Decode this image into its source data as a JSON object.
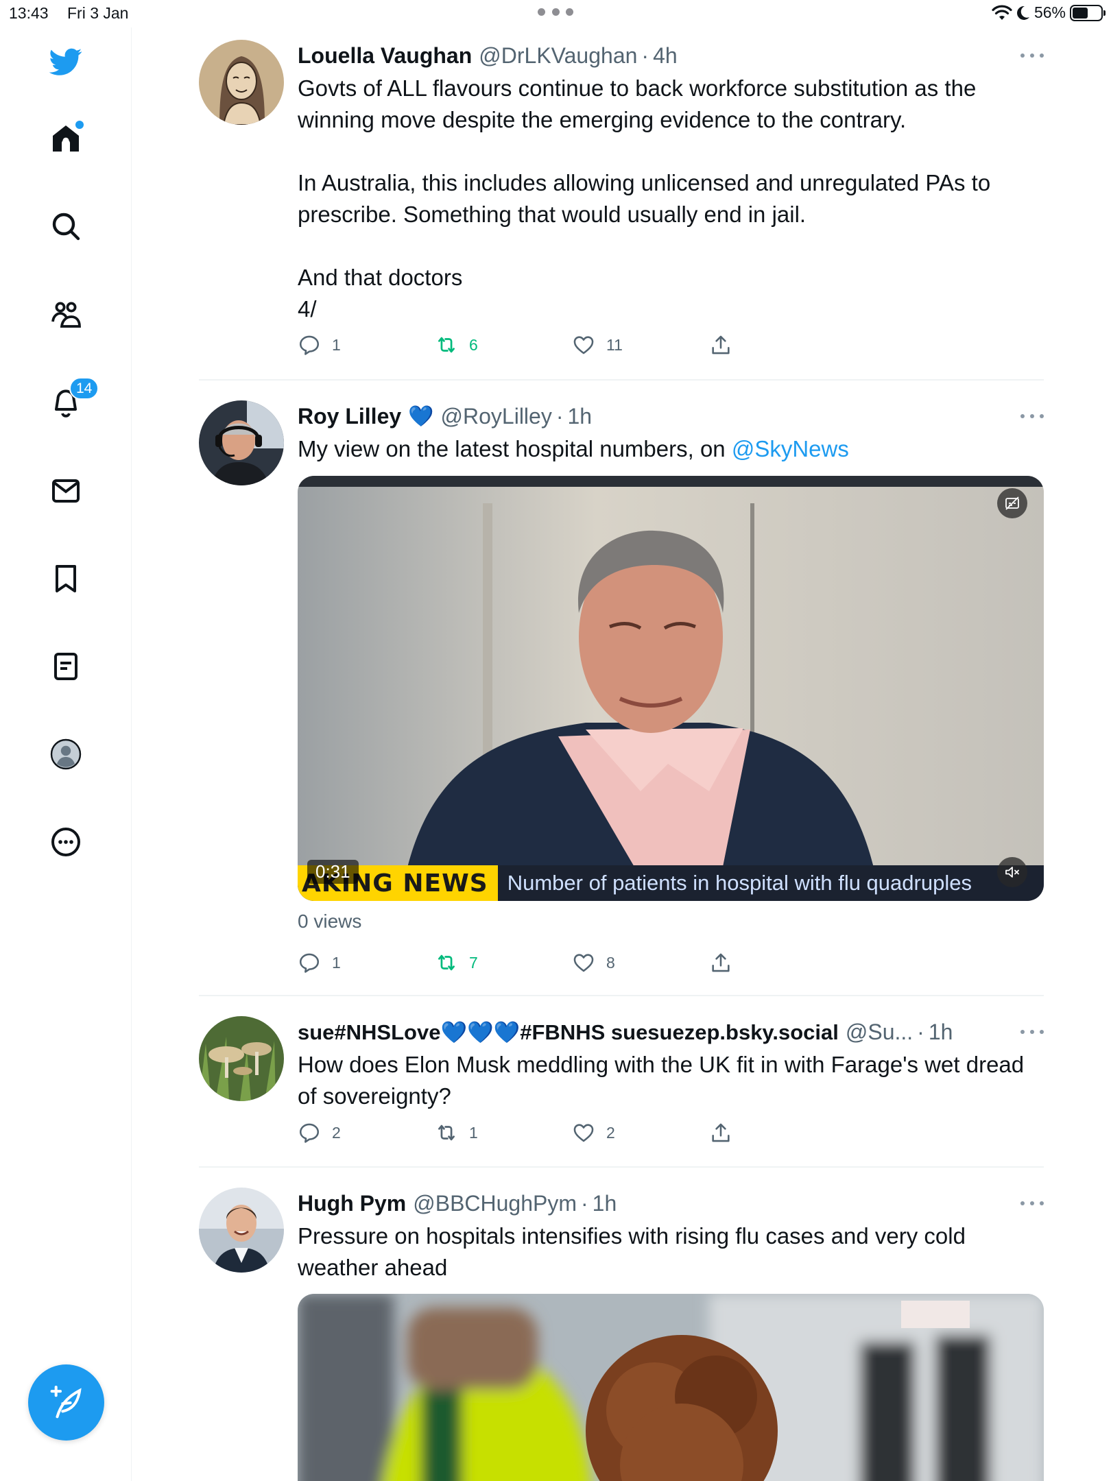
{
  "status_bar": {
    "time": "13:43",
    "date": "Fri 3 Jan",
    "battery": "56%",
    "battery_level": 0.56
  },
  "sidebar": {
    "items": [
      {
        "icon": "home-icon",
        "label": "Home"
      },
      {
        "icon": "search-icon",
        "label": "Explore"
      },
      {
        "icon": "communities-icon",
        "label": "Communities"
      },
      {
        "icon": "bell-icon",
        "label": "Notifications"
      },
      {
        "icon": "mail-icon",
        "label": "Messages"
      },
      {
        "icon": "bookmark-icon",
        "label": "Bookmarks"
      },
      {
        "icon": "lists-icon",
        "label": "Lists"
      },
      {
        "icon": "profile-icon",
        "label": "Profile"
      },
      {
        "icon": "more-circle-icon",
        "label": "More"
      }
    ],
    "notifications_badge": "14",
    "compose_icon": "compose-feather-icon"
  },
  "colors": {
    "accent": "#1d9bf0",
    "retweet": "#00ba7c",
    "text_primary": "#0f1419",
    "text_secondary": "#536471",
    "divider": "#eff3f4"
  },
  "tweets": [
    {
      "name": "Louella Vaughan",
      "handle": "@DrLKVaughan",
      "sep": "·",
      "time": "4h",
      "text": "Govts of ALL flavours continue to back workforce substitution as the winning move despite the emerging evidence to the contrary.\n\nIn Australia, this includes allowing unlicensed and unregulated PAs to prescribe. Something that would usually end in jail.\n\nAnd that doctors\n4/",
      "replies": "1",
      "retweets": "6",
      "likes": "11"
    },
    {
      "name": "Roy Lilley",
      "name_emoji": "💙",
      "handle": "@RoyLilley",
      "sep": "·",
      "time": "1h",
      "text_prefix": "My view on the latest hospital numbers, on ",
      "mention": "@SkyNews",
      "video": {
        "duration": "0:31",
        "ticker_tag": "AKING NEWS",
        "ticker_text": "Number of patients in hospital with flu quadruples"
      },
      "views": "0 views",
      "replies": "1",
      "retweets": "7",
      "likes": "8"
    },
    {
      "name": "sue#NHSLove💙💙💙#FBNHS suesuezep.bsky.social",
      "handle": "@Su...",
      "sep": "·",
      "time": "1h",
      "text": "How does Elon Musk meddling with the UK fit in with Farage's wet dread of sovereignty?",
      "replies": "2",
      "retweets": "1",
      "likes": "2"
    },
    {
      "name": "Hugh Pym",
      "handle": "@BBCHughPym",
      "sep": "·",
      "time": "1h",
      "text": "Pressure on hospitals intensifies with rising flu cases and very cold weather ahead"
    }
  ]
}
